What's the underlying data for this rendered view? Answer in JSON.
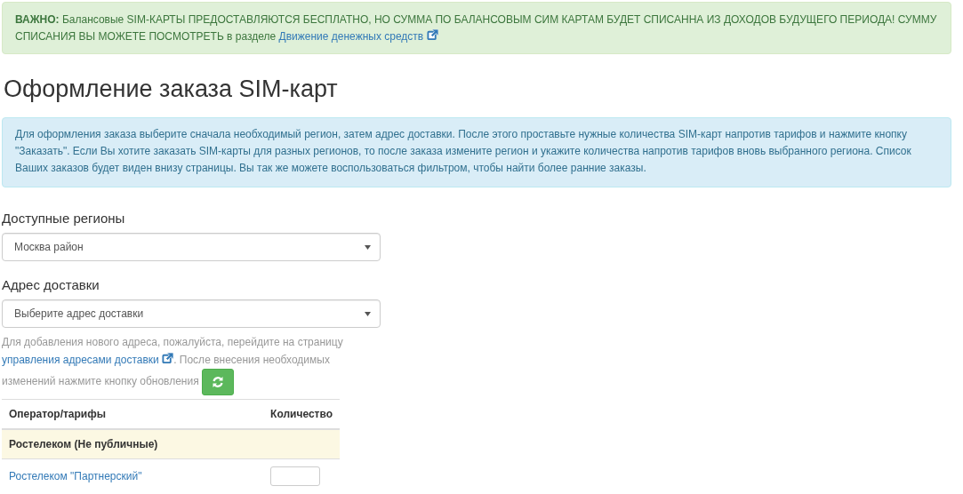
{
  "warning": {
    "text": "**ВАЖНО:** Балансовые SIM-КАРТЫ ПРЕДОСТАВЛЯЮТСЯ БЕСПЛАТНО, НО СУММА ПО БАЛАНСОВЫМ СИМ КАРТАМ БУДЕТ СПИСАННА ИЗ ДОХОДОВ БУДУЩЕГО ПЕРИОДА! СУММУ СПИСАНИЯ ВЫ МОЖЕТЕ ПОСМОТРЕТЬ в разделе",
    "link": "Движение денежных средств"
  },
  "heading": "Оформление заказа SIM-карт",
  "info": "Для оформления заказа выберите сначала необходимый регион, затем адрес доставки. После этого проставьте нужные количества SIM-карт напротив тарифов и нажмите кнопку \"Заказать\". Если Вы хотите заказать SIM-карты для разных регионов, то после заказа измените регион и укажите количества напротив тарифов вновь выбранного региона. Список Ваших заказов будет виден внизу страницы. Вы так же можете воспользоваться фильтром, чтобы найти более ранние заказы.",
  "region": {
    "label": "Доступные регионы",
    "value": "Москва район"
  },
  "address": {
    "label": "Адрес доставки",
    "value": "Выберите адрес доставки",
    "help_before": "Для добавления нового адреса, пожалуйста, перейдите на страницу",
    "help_link": "управления адресами доставки",
    "help_after": ". После внесения необходимых изменений нажмите кнопку обновления"
  },
  "table": {
    "columns": [
      "Оператор/тарифы",
      "Количество"
    ],
    "rows": [
      {
        "kind": "group",
        "label": "Ростелеком (Не публичные)"
      },
      {
        "kind": "tariff",
        "label": "Ростелеком \"Партнерский\""
      }
    ]
  }
}
